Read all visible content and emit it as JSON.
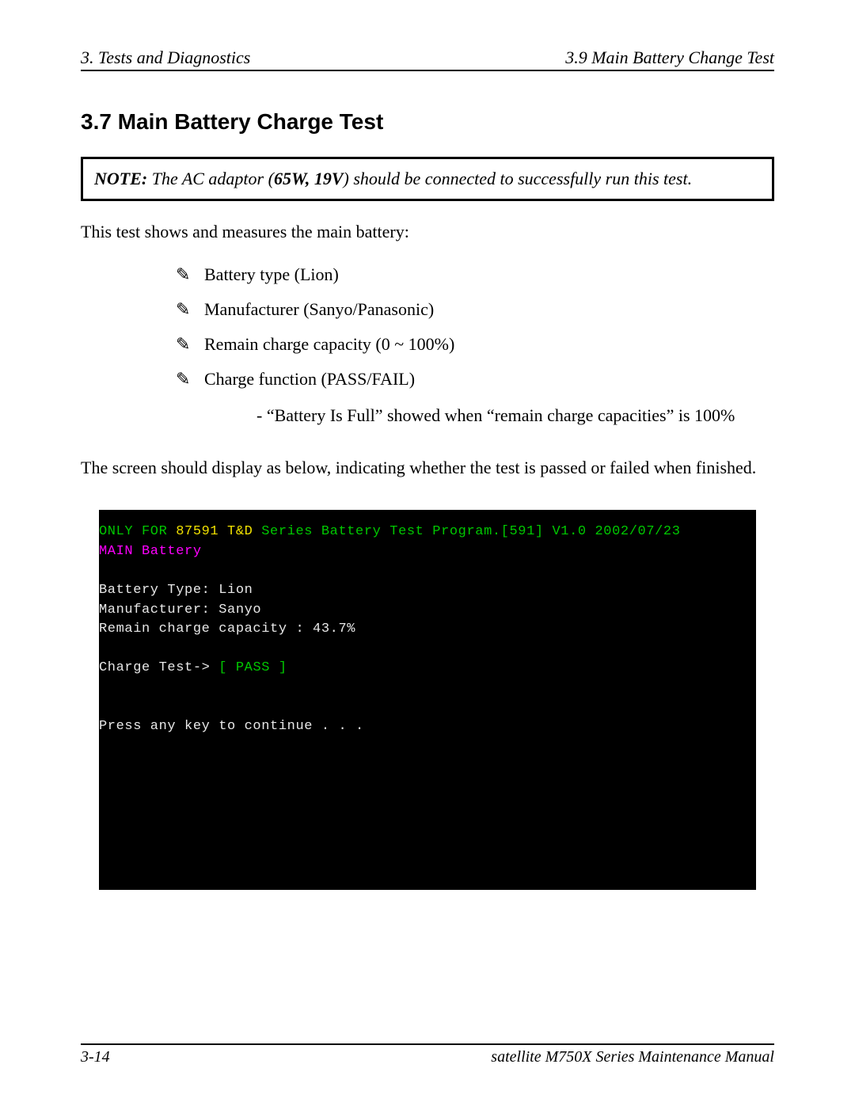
{
  "header": {
    "left": "3.  Tests and Diagnostics",
    "right": "3.9 Main Battery Change Test"
  },
  "section_title": "3.7 Main Battery Charge Test",
  "note": {
    "label": "NOTE:",
    "before": "  The AC adaptor (",
    "bold": "65W, 19V",
    "after": ") should be connected to successfully run this test."
  },
  "intro": "This test shows and measures the main battery:",
  "bullets": [
    "Battery type (Lion)",
    "Manufacturer (Sanyo/Panasonic)",
    "Remain charge capacity (0 ~ 100%)",
    "Charge function (PASS/FAIL)"
  ],
  "bullet_sub": "- “Battery Is Full” showed when “remain charge capacities” is 100%",
  "after_list": "The screen should display as below, indicating whether the test is passed or failed when finished.",
  "terminal": {
    "l1a": "ONLY FOR ",
    "l1b": "87591 T&D",
    "l1c": " Series Battery Test Program.[591] V1.0 2002/07/23",
    "l2": "MAIN Battery",
    "l3": "Battery Type: Lion",
    "l4": "Manufacturer: Sanyo",
    "l5": "Remain charge capacity : 43.7%",
    "l6a": "Charge Test-> ",
    "l6b": "[ PASS ]",
    "l7": "Press any key to continue . . ."
  },
  "footer": {
    "left": "3-14",
    "right": "satellite M750X Series Maintenance Manual"
  }
}
